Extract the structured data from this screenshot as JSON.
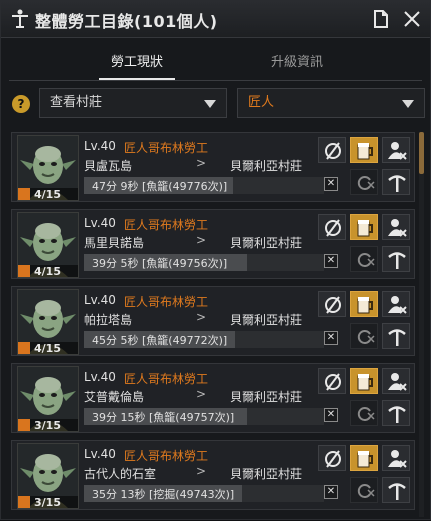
{
  "window": {
    "title": "整體勞工目錄(101個人)"
  },
  "tabs": [
    {
      "label": "勞工現狀",
      "active": true
    },
    {
      "label": "升級資訊",
      "active": false
    }
  ],
  "filters": {
    "help": "?",
    "village": "查看村莊",
    "grade": "匠人"
  },
  "workers": [
    {
      "level": "Lv.40",
      "name": "匠人哥布林勞工",
      "location": "貝盧瓦島",
      "arrow": ">",
      "village": "貝爾利亞村莊",
      "stamina": "4/15",
      "task": "47分 9秒 [魚籠(49776次)]",
      "progress": 0.62
    },
    {
      "level": "Lv.40",
      "name": "匠人哥布林勞工",
      "location": "馬里貝諾島",
      "arrow": ">",
      "village": "貝爾利亞村莊",
      "stamina": "4/15",
      "task": "39分 5秒 [魚籠(49756次)]",
      "progress": 0.68
    },
    {
      "level": "Lv.40",
      "name": "匠人哥布林勞工",
      "location": "帕拉塔島",
      "arrow": ">",
      "village": "貝爾利亞村莊",
      "stamina": "4/15",
      "task": "45分 5秒 [魚籠(49772次)]",
      "progress": 0.63
    },
    {
      "level": "Lv.40",
      "name": "匠人哥布林勞工",
      "location": "艾普戴倫島",
      "arrow": ">",
      "village": "貝爾利亞村莊",
      "stamina": "3/15",
      "task": "39分 15秒 [魚籠(49757次)]",
      "progress": 0.68
    },
    {
      "level": "Lv.40",
      "name": "匠人哥布林勞工",
      "location": "古代人的石室",
      "arrow": ">",
      "village": "貝爾利亞村莊",
      "stamina": "3/15",
      "task": "35分 13秒 [挖掘(49743次)]",
      "progress": 0.66
    }
  ],
  "colors": {
    "accent_orange": "#e07a1e",
    "gold_button": "#c8932c",
    "stamina": "#d9751e"
  },
  "icons": {
    "title": "worker-emblem-icon",
    "note": "document-icon",
    "close": "close-icon",
    "action1": "no-food-icon",
    "action2": "beer-mug-icon",
    "action3": "fire-worker-icon",
    "action4": "repeat-icon",
    "action5": "pickaxe-upgrade-icon"
  }
}
